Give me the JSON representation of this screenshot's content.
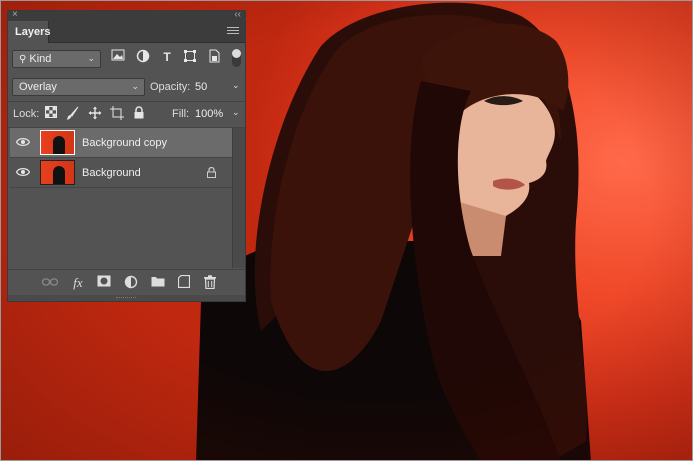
{
  "panel": {
    "close_glyph": "×",
    "collapse_glyph": "‹‹",
    "tab_label": "Layers",
    "filter": {
      "label": "Kind"
    },
    "blend_mode": "Overlay",
    "opacity_label": "Opacity:",
    "opacity_value": "50",
    "lock_label": "Lock:",
    "fill_label": "Fill:",
    "fill_value": "100%",
    "layers": [
      {
        "name": "Background copy",
        "selected": true,
        "locked": false
      },
      {
        "name": "Background",
        "selected": false,
        "locked": true
      }
    ]
  },
  "icons": {
    "filter_icons": [
      "image-filter-icon",
      "adjustment-filter-icon",
      "type-filter-icon",
      "shape-filter-icon",
      "smart-object-filter-icon"
    ],
    "lock_icons": [
      "lock-transparent-pixels-icon",
      "lock-image-pixels-icon",
      "lock-position-icon",
      "lock-artboard-icon",
      "lock-all-icon"
    ],
    "bottom_icons": [
      "link-layers-icon",
      "fx-icon",
      "add-mask-icon",
      "new-adjustment-icon",
      "new-group-icon",
      "new-layer-icon",
      "trash-icon"
    ]
  },
  "colors": {
    "panel_bg": "#535353",
    "selected_row": "#6b6b6b",
    "canvas_red": "#e8401e"
  }
}
